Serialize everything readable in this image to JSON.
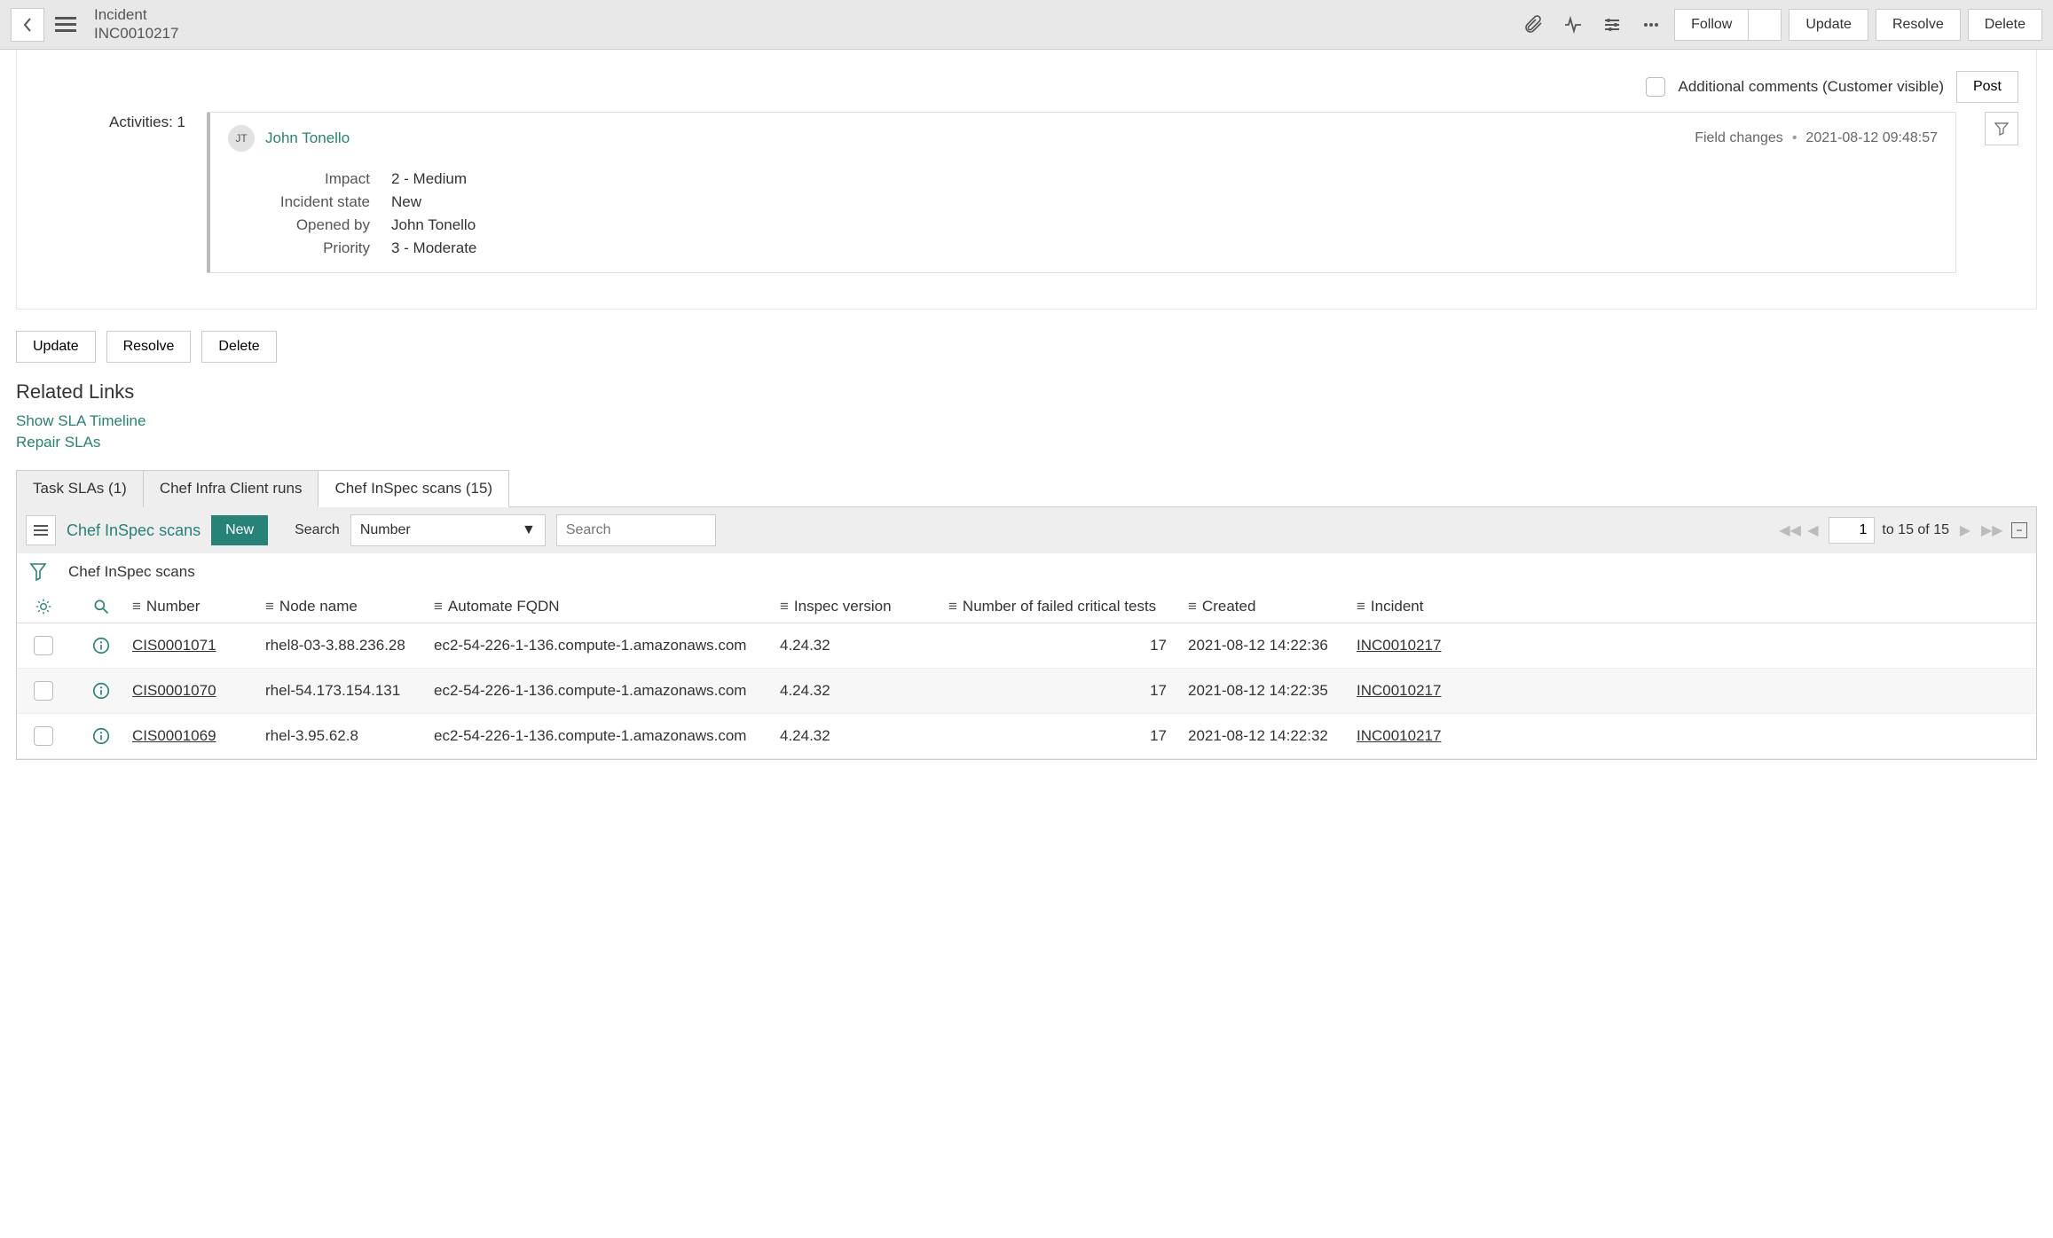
{
  "header": {
    "entity": "Incident",
    "number": "INC0010217",
    "follow": "Follow",
    "update": "Update",
    "resolve": "Resolve",
    "delete": "Delete"
  },
  "comment_bar": {
    "checkbox_label": "Additional comments (Customer visible)",
    "post": "Post"
  },
  "activities": {
    "label": "Activities: 1",
    "author_initials": "JT",
    "author": "John Tonello",
    "meta_label": "Field changes",
    "timestamp": "2021-08-12 09:48:57",
    "fields": [
      {
        "label": "Impact",
        "value": "2 - Medium"
      },
      {
        "label": "Incident state",
        "value": "New"
      },
      {
        "label": "Opened by",
        "value": "John Tonello"
      },
      {
        "label": "Priority",
        "value": "3 - Moderate"
      }
    ]
  },
  "bottom_actions": {
    "update": "Update",
    "resolve": "Resolve",
    "delete": "Delete"
  },
  "related": {
    "title": "Related Links",
    "links": [
      "Show SLA Timeline",
      "Repair SLAs"
    ]
  },
  "tabs": [
    {
      "label": "Task SLAs (1)",
      "active": false
    },
    {
      "label": "Chef Infra Client runs",
      "active": false
    },
    {
      "label": "Chef InSpec scans (15)",
      "active": true
    }
  ],
  "list": {
    "title": "Chef InSpec scans",
    "new": "New",
    "search_label": "Search",
    "search_field": "Number",
    "search_placeholder": "Search",
    "pager": {
      "current": "1",
      "range": "to 15 of 15"
    },
    "breadcrumb": "Chef InSpec scans",
    "columns": [
      "Number",
      "Node name",
      "Automate FQDN",
      "Inspec version",
      "Number of failed critical tests",
      "Created",
      "Incident"
    ],
    "rows": [
      {
        "number": "CIS0001071",
        "node": "rhel8-03-3.88.236.28",
        "fqdn": "ec2-54-226-1-136.compute-1.amazonaws.com",
        "ver": "4.24.32",
        "failed": "17",
        "created": "2021-08-12 14:22:36",
        "incident": "INC0010217"
      },
      {
        "number": "CIS0001070",
        "node": "rhel-54.173.154.131",
        "fqdn": "ec2-54-226-1-136.compute-1.amazonaws.com",
        "ver": "4.24.32",
        "failed": "17",
        "created": "2021-08-12 14:22:35",
        "incident": "INC0010217"
      },
      {
        "number": "CIS0001069",
        "node": "rhel-3.95.62.8",
        "fqdn": "ec2-54-226-1-136.compute-1.amazonaws.com",
        "ver": "4.24.32",
        "failed": "17",
        "created": "2021-08-12 14:22:32",
        "incident": "INC0010217"
      }
    ]
  }
}
